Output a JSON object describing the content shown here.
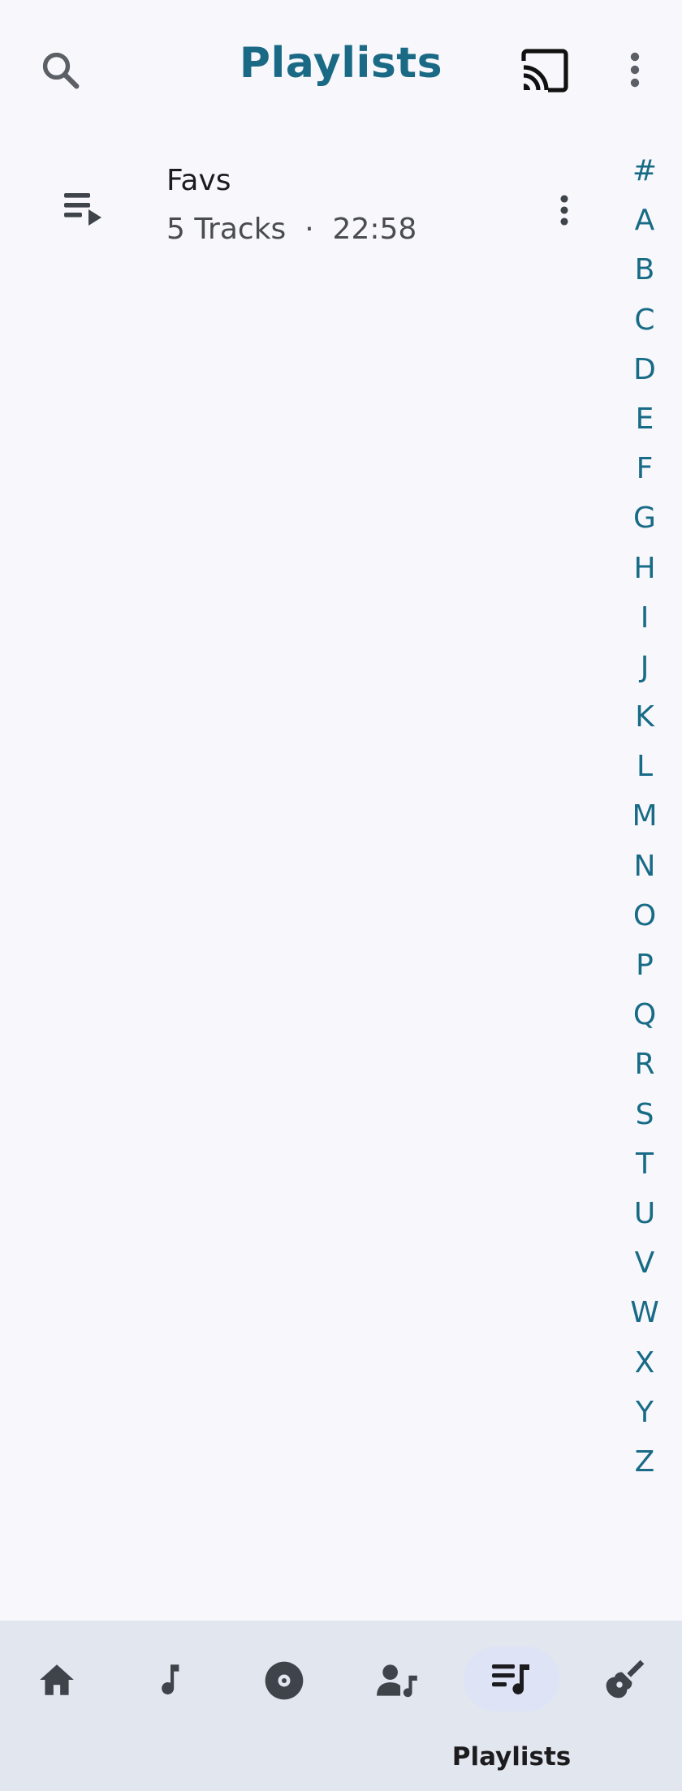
{
  "header": {
    "title": "Playlists",
    "icons": [
      "search-icon",
      "cast-icon",
      "more-vert-icon"
    ]
  },
  "playlists": [
    {
      "name": "Favs",
      "tracks": "5 Tracks",
      "separator": "·",
      "duration": "22:58",
      "icon": "playlist-play-icon"
    }
  ],
  "index_letters": [
    "#",
    "A",
    "B",
    "C",
    "D",
    "E",
    "F",
    "G",
    "H",
    "I",
    "J",
    "K",
    "L",
    "M",
    "N",
    "O",
    "P",
    "Q",
    "R",
    "S",
    "T",
    "U",
    "V",
    "W",
    "X",
    "Y",
    "Z"
  ],
  "bottom_nav": {
    "items": [
      {
        "icon": "home-icon",
        "label": ""
      },
      {
        "icon": "music-note-icon",
        "label": ""
      },
      {
        "icon": "album-icon",
        "label": ""
      },
      {
        "icon": "artist-icon",
        "label": ""
      },
      {
        "icon": "playlist-music-icon",
        "label": "Playlists",
        "active": true
      },
      {
        "icon": "guitar-icon",
        "label": ""
      }
    ]
  },
  "colors": {
    "accent": "#1b6a85",
    "background": "#f8f8fc",
    "nav_background": "#e2e6ee",
    "nav_active_pill": "#dfe3f6",
    "icon": "#3f434a"
  }
}
